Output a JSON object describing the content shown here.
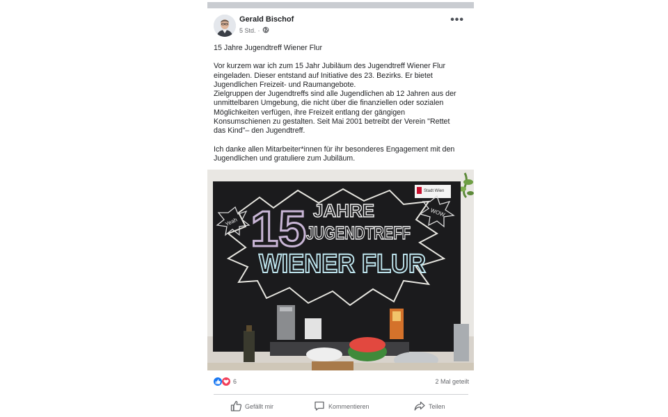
{
  "post": {
    "author": "Gerald Bischof",
    "time": "5 Std.",
    "time_separator": "·",
    "privacy_icon": "globe-icon",
    "menu_icon": "more-icon",
    "menu_glyph": "•••"
  },
  "content": {
    "title": "15 Jahre Jugendtreff Wiener Flur",
    "paragraph1": "Vor kurzem war ich zum 15 Jahr Jubiläum des Jugendtreff Wiener Flur eingeladen. Dieser entstand auf Initiative des 23. Bezirks. Er bietet Jugendlichen Freizeit- und Raumangebote.\nZielgruppen der Jugendtreffs sind alle Jugendlichen ab 12 Jahren aus der unmittelbaren Umgebung, die nicht über die finanziellen oder sozialen Möglichkeiten verfügen, ihre Freizeit entlang der gängigen Konsumschienen zu gestalten. Seit Mai 2001 betreibt der Verein \"Rettet das Kind\"– den Jugendtreff.",
    "paragraph2": "Ich danke allen Mitarbeiter*innen für ihr besonderes Engagement mit den Jugendlichen und gratuliere zum Jubiläum."
  },
  "photo": {
    "board": {
      "number": "15",
      "line1": "JAHRE",
      "line2": "JUGENDTREFF",
      "line3": "WIENER FLUR",
      "burst_left": "Yeah",
      "burst_right": "WOW",
      "sign": "Stadt Wien"
    }
  },
  "stats": {
    "reaction_icons": [
      "like-reaction-icon",
      "love-reaction-icon"
    ],
    "reaction_count": "6",
    "shares": "2 Mal geteilt"
  },
  "actions": {
    "like": "Gefällt mir",
    "comment": "Kommentieren",
    "share": "Teilen"
  },
  "colors": {
    "text": "#1c1e21",
    "secondary": "#65676b",
    "like_blue": "#1877f2",
    "love_red": "#f33e58",
    "chalkboard": "#1b1b1d"
  }
}
